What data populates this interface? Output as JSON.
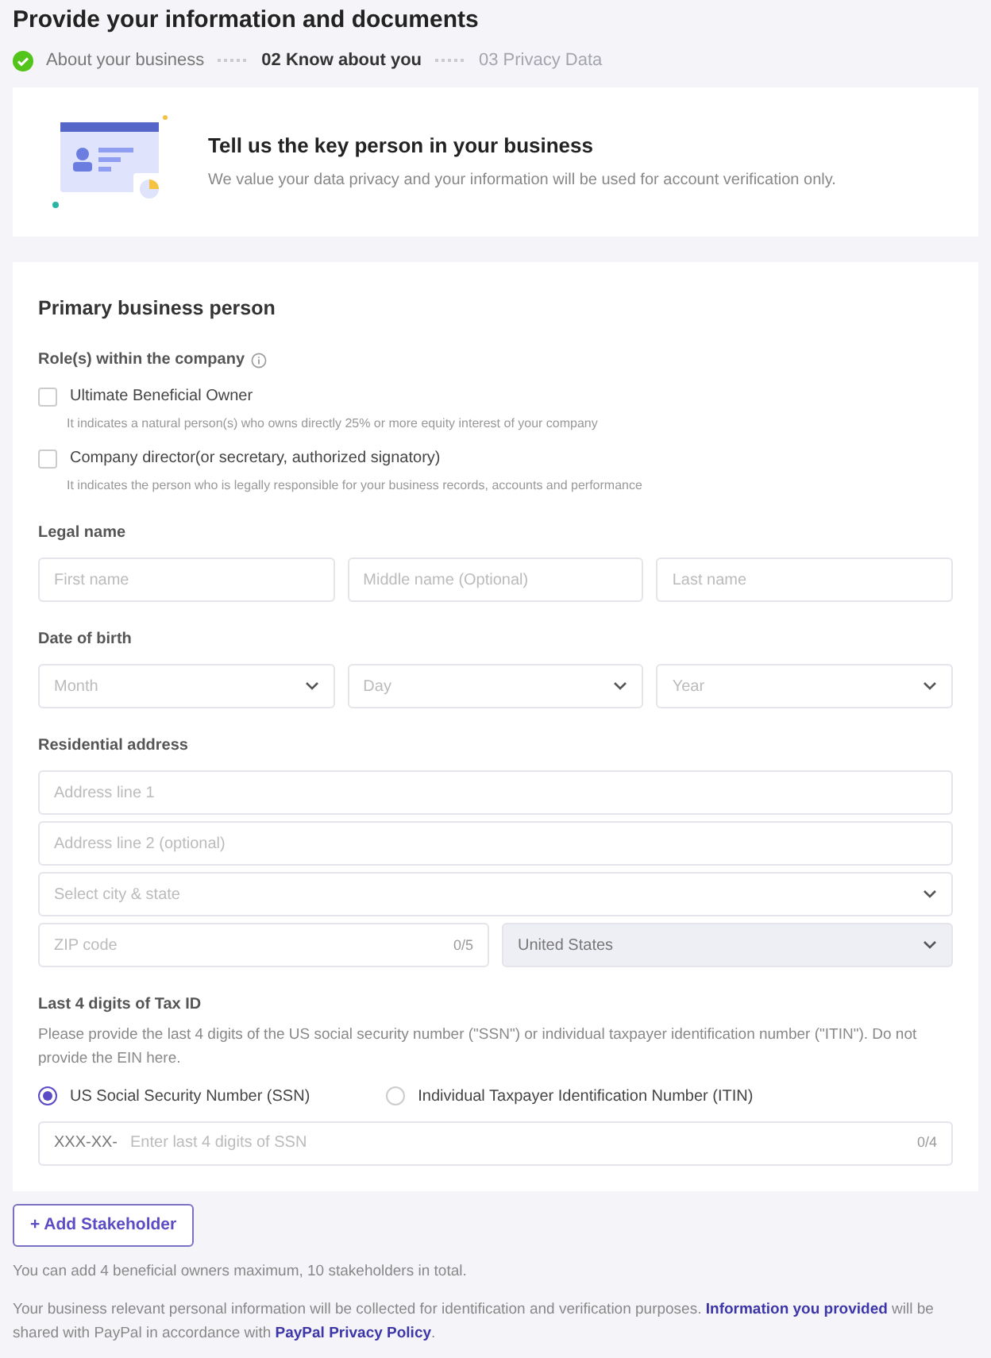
{
  "title": "Provide your information and documents",
  "steps": [
    {
      "label": "About your business",
      "completed": true,
      "selected": false
    },
    {
      "label": "02 Know about you",
      "completed": false,
      "selected": true
    },
    {
      "label": "03 Privacy Data",
      "completed": false,
      "selected": false
    }
  ],
  "banner": {
    "title": "Tell us the key person in your business",
    "text": "We value your data privacy and your information will be used for account verification only."
  },
  "form": {
    "heading": "Primary business person",
    "roles": {
      "label": "Role(s) within the company",
      "options": [
        {
          "label": "Ultimate Beneficial Owner",
          "hint": "It indicates a natural person(s) who owns directly 25% or more equity interest of your company",
          "checked": false
        },
        {
          "label": "Company director(or secretary, authorized signatory)",
          "hint": "It indicates the person who is legally responsible for your business records, accounts and performance",
          "checked": false
        }
      ]
    },
    "sections": [
      {
        "label": "Legal name",
        "rows": [
          [
            {
              "kind": "input",
              "placeholder": "First name"
            },
            {
              "kind": "input",
              "placeholder": "Middle name (Optional)"
            },
            {
              "kind": "input",
              "placeholder": "Last name"
            }
          ]
        ]
      },
      {
        "label": "Date of birth",
        "rows": [
          [
            {
              "kind": "select",
              "placeholder": "Month"
            },
            {
              "kind": "select",
              "placeholder": "Day"
            },
            {
              "kind": "select",
              "placeholder": "Year"
            }
          ]
        ]
      },
      {
        "label": "Residential address",
        "rows": [
          [
            {
              "kind": "input",
              "placeholder": "Address line 1"
            }
          ],
          [
            {
              "kind": "input",
              "placeholder": "Address line 2 (optional)"
            }
          ],
          [
            {
              "kind": "select",
              "placeholder": "Select city & state"
            }
          ],
          [
            {
              "kind": "input",
              "placeholder": "ZIP code",
              "counter": "0/5"
            },
            {
              "kind": "select",
              "value": "United States",
              "disabled": true
            }
          ]
        ]
      }
    ],
    "tax": {
      "label": "Last 4 digits of Tax ID",
      "help": "Please provide the last 4 digits of the US social security number (\"SSN\") or individual taxpayer identification number (\"ITIN\"). Do not provide the EIN here.",
      "options": [
        {
          "label": "US Social Security Number (SSN)",
          "selected": true
        },
        {
          "label": "Individual Taxpayer Identification Number (ITIN)",
          "selected": false
        }
      ],
      "prefix": "XXX-XX-",
      "placeholder": "Enter last 4 digits of SSN",
      "counter": "0/4"
    }
  },
  "add_button": "+ Add Stakeholder",
  "notes": [
    [
      {
        "text": "You can add 4 beneficial owners maximum, 10 stakeholders in total."
      }
    ],
    [
      {
        "text": "Your business relevant personal information will be collected for identification and verification purposes. "
      },
      {
        "text": "Information you provided",
        "link": true
      },
      {
        "text": " will be shared with PayPal in accordance with "
      },
      {
        "text": "PayPal Privacy Policy",
        "link": true
      },
      {
        "text": "."
      }
    ]
  ]
}
